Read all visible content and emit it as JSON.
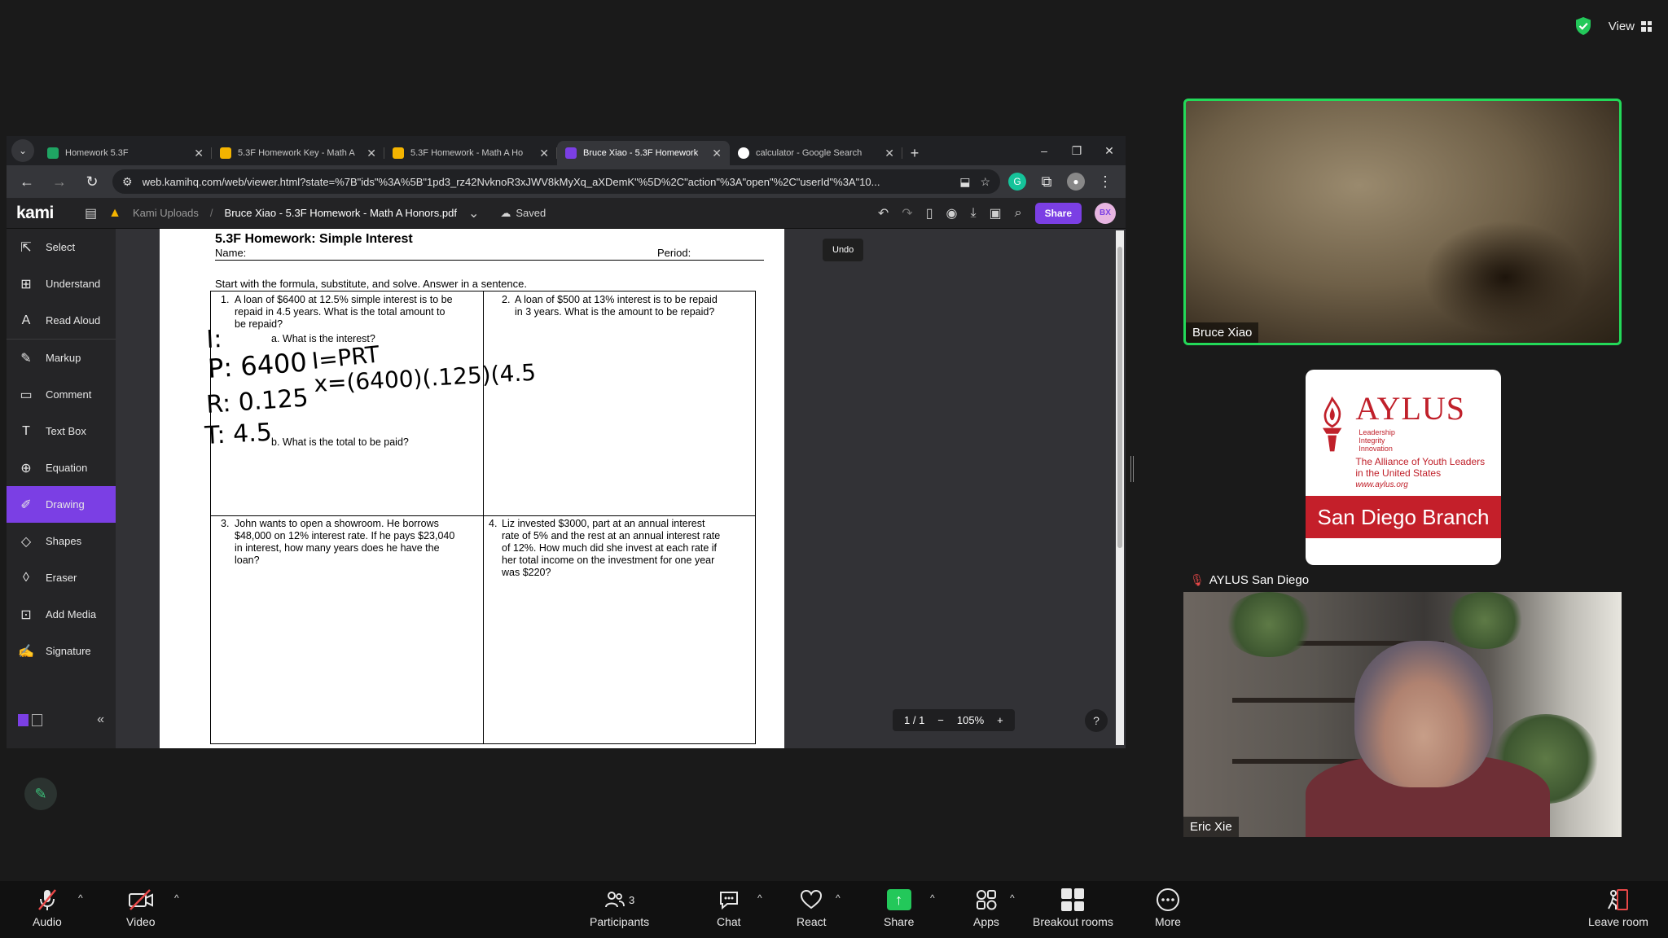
{
  "zoom_top": {
    "view_label": "View"
  },
  "browser": {
    "tabs": [
      {
        "title": "Homework 5.3F",
        "color": "#1fa463"
      },
      {
        "title": "5.3F Homework Key - Math A",
        "color": "#f4b400"
      },
      {
        "title": "5.3F Homework - Math A Ho",
        "color": "#f4b400"
      },
      {
        "title": "Bruce Xiao - 5.3F Homework",
        "color": "#7b3fe4"
      },
      {
        "title": "calculator - Google Search",
        "color": "#ffffff"
      }
    ],
    "url": "web.kamihq.com/web/viewer.html?state=%7B\"ids\"%3A%5B\"1pd3_rz42NvknoR3xJWV8kMyXq_aXDemK\"%5D%2C\"action\"%3A\"open\"%2C\"userId\"%3A\"10..."
  },
  "kami": {
    "logo": "kami",
    "crumb_root": "Kami Uploads",
    "crumb_sep": "/",
    "file_name": "Bruce Xiao - 5.3F Homework - Math A Honors.pdf",
    "saved": "Saved",
    "share": "Share",
    "avatar": "BX",
    "undo_tooltip": "Undo",
    "page": "1 / 1",
    "zoom": "105%",
    "tools": [
      {
        "label": "Select",
        "icon": "cursor-icon"
      },
      {
        "label": "Understand",
        "icon": "understand-icon"
      },
      {
        "label": "Read Aloud",
        "icon": "read-aloud-icon"
      },
      {
        "label": "Markup",
        "icon": "markup-icon"
      },
      {
        "label": "Comment",
        "icon": "comment-icon"
      },
      {
        "label": "Text Box",
        "icon": "text-box-icon"
      },
      {
        "label": "Equation",
        "icon": "equation-icon"
      },
      {
        "label": "Drawing",
        "icon": "drawing-icon"
      },
      {
        "label": "Shapes",
        "icon": "shapes-icon"
      },
      {
        "label": "Eraser",
        "icon": "eraser-icon"
      },
      {
        "label": "Add Media",
        "icon": "add-media-icon"
      },
      {
        "label": "Signature",
        "icon": "signature-icon"
      }
    ],
    "active_tool": "Drawing"
  },
  "doc": {
    "title": "5.3F Homework: Simple Interest",
    "name_label": "Name:",
    "period_label": "Period:",
    "intro": "Start with the formula, substitute, and solve.  Answer in a sentence.",
    "q1_num": "1.",
    "q1_lines": [
      "A loan of $6400 at 12.5% simple interest is to be",
      "repaid in 4.5 years.  What is the total amount to",
      "be repaid?"
    ],
    "q1a": "a.   What is the interest?",
    "q1b": "b.   What is the total to be paid?",
    "q2_num": "2.",
    "q2_lines": [
      "A loan of $500 at 13% interest is to be repaid",
      "in 3 years.  What is the amount to be repaid?"
    ],
    "q3_num": "3.",
    "q3_lines": [
      "John wants to open a showroom. He borrows",
      "$48,000 on 12% interest rate. If he pays $23,040",
      "in interest, how many years does he have the",
      "loan?"
    ],
    "q4_num": "4.",
    "q4_lines": [
      "Liz invested $3000, part at an annual interest",
      "rate of 5% and the rest at an annual interest rate",
      "of 12%.  How much did she invest at each rate if",
      "her total income on the investment for one year",
      "was $220?"
    ],
    "handwriting": {
      "i": "I:",
      "p": "P: 6400",
      "formula": "I=PRT",
      "sub": "x=(6400)(.125)(4.5",
      "r": "R: 0.125",
      "t": "T: 4.5"
    }
  },
  "participants": {
    "bruce": "Bruce Xiao",
    "aylus": "AYLUS San Diego",
    "eric": "Eric Xie"
  },
  "aylus_logo": {
    "word": "AYLUS",
    "tagline": [
      "Leadership",
      "Integrity",
      "Innovation"
    ],
    "subtitle": [
      "The Alliance of Youth Leaders",
      "in the United States"
    ],
    "url": "www.aylus.org",
    "branch": "San Diego Branch"
  },
  "toolbar": {
    "audio": "Audio",
    "video": "Video",
    "participants": "Participants",
    "participants_count": "3",
    "chat": "Chat",
    "react": "React",
    "share": "Share",
    "apps": "Apps",
    "breakout": "Breakout rooms",
    "more": "More",
    "leave": "Leave room"
  },
  "colors": {
    "accent_purple": "#7b3fe4",
    "speaker_green": "#23d959",
    "share_green": "#23c85a",
    "aylus_red": "#c41f2a"
  }
}
